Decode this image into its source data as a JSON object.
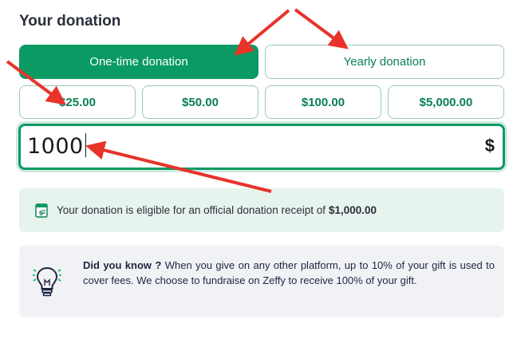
{
  "section_title": "Your donation",
  "frequency": {
    "one_time_label": "One-time donation",
    "yearly_label": "Yearly donation",
    "selected": "one_time"
  },
  "preset_amounts": [
    "$25.00",
    "$50.00",
    "$100.00",
    "$5,000.00"
  ],
  "amount_input": {
    "value": "1000",
    "currency_symbol": "$"
  },
  "receipt_notice": {
    "text": "Your donation is eligible for an official donation receipt of",
    "amount": "$1,000.00"
  },
  "did_you_know": {
    "heading": "Did you know ?",
    "text": "When you give on any other platform, up to 10% of your gift is used to cover fees. We choose to fundraise on Zeffy to receive 100% of your gift."
  },
  "colors": {
    "brand_green": "#0a9a63",
    "brand_green_text": "#0a7f52",
    "receipt_bg": "#e7f4ee",
    "info_bg": "#f1f2f5",
    "annotation_red": "#e8332a"
  },
  "icons": [
    "receipt-icon",
    "lightbulb-icon"
  ]
}
